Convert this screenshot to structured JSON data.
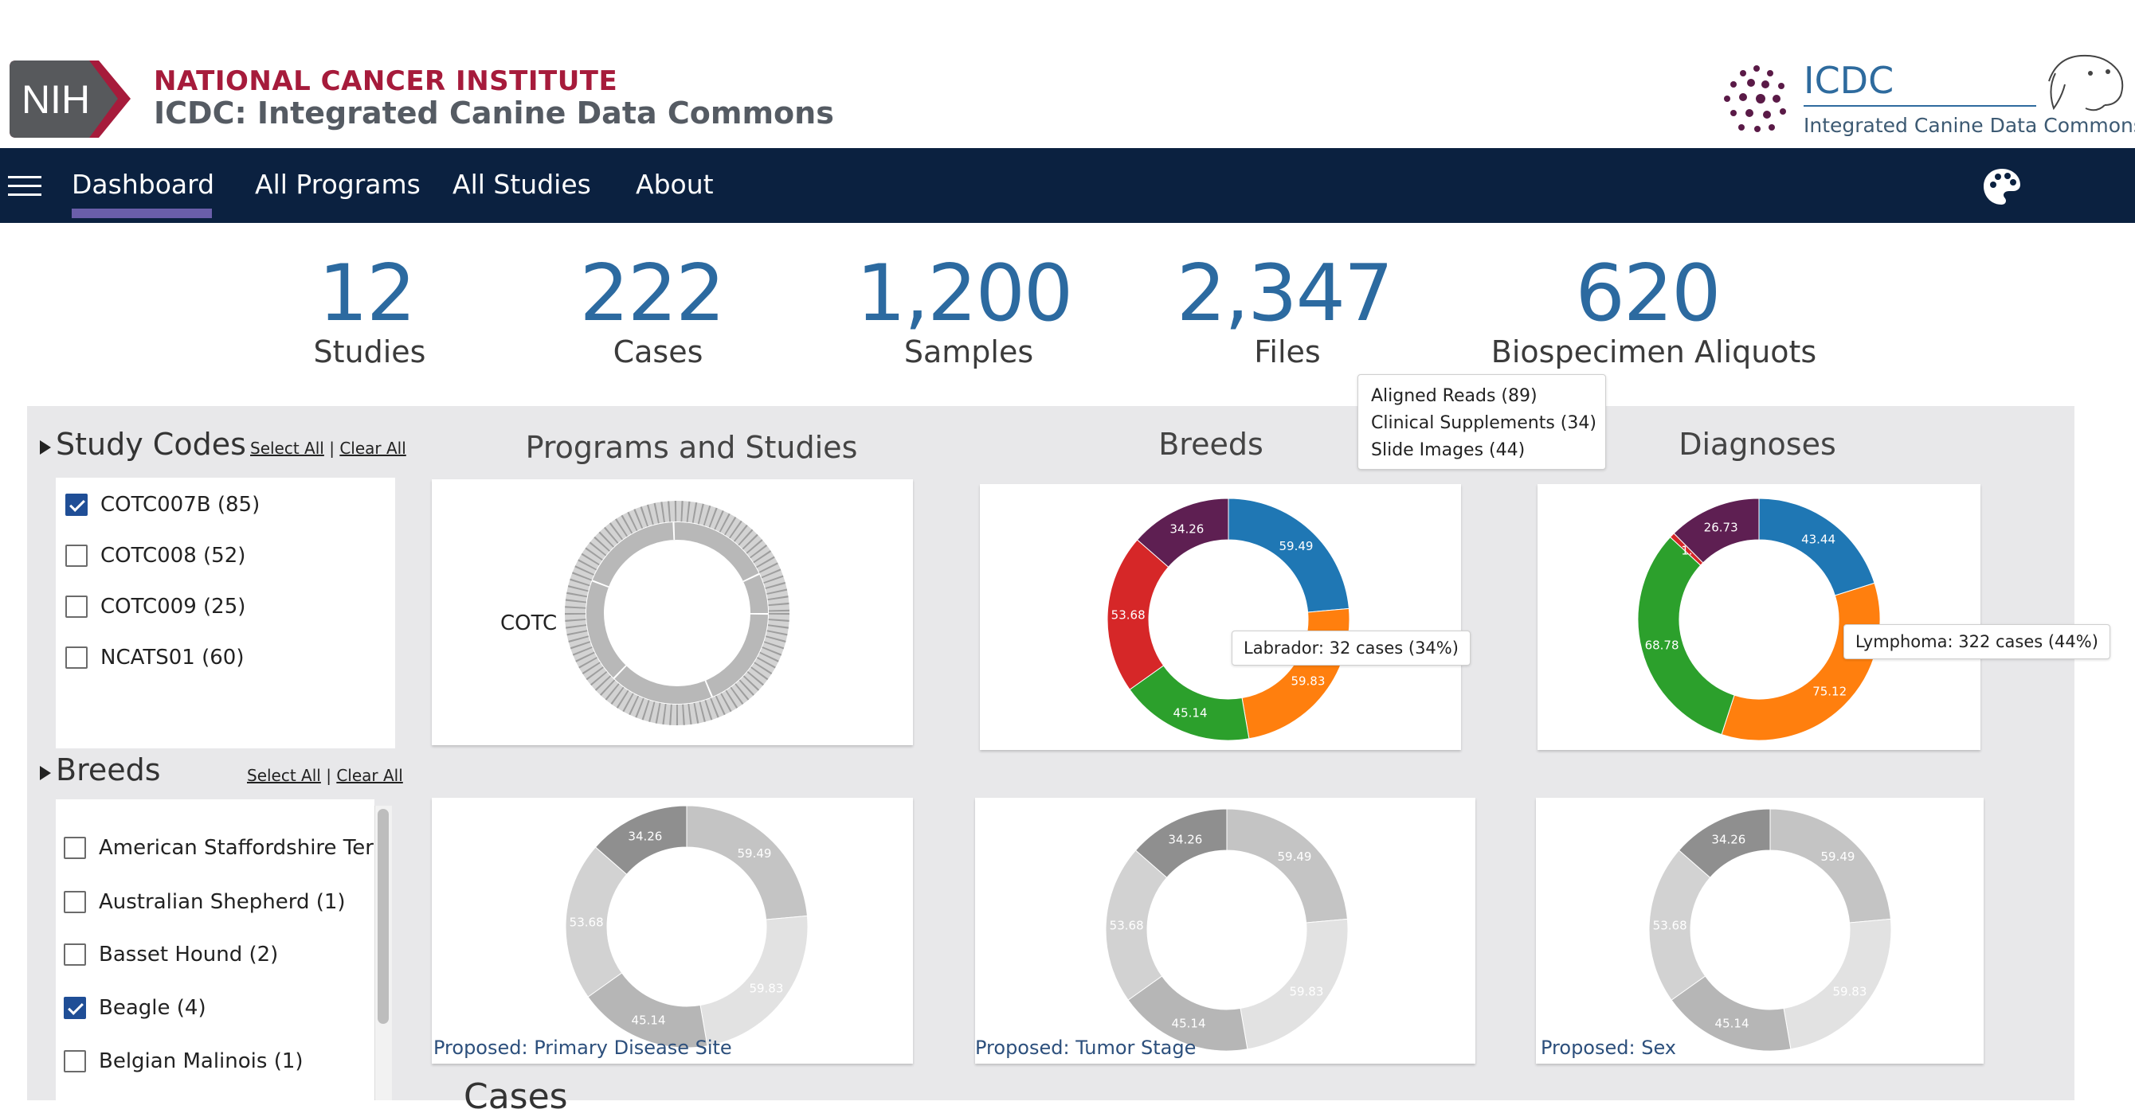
{
  "header": {
    "nih_logo_text": "NIH",
    "nci_title": "NATIONAL CANCER INSTITUTE",
    "icdc_title": "ICDC: Integrated Canine Data Commons",
    "icdc_logo_word": "ICDC",
    "icdc_logo_sub": "Integrated Canine Data Commons"
  },
  "nav": {
    "items": [
      "Dashboard",
      "All Programs",
      "All Studies",
      "About"
    ],
    "active": "Dashboard"
  },
  "stats": [
    {
      "value": "12",
      "label": "Studies"
    },
    {
      "value": "222",
      "label": "Cases"
    },
    {
      "value": "1,200",
      "label": "Samples"
    },
    {
      "value": "2,347",
      "label": "Files"
    },
    {
      "value": "620",
      "label": "Biospecimen Aliquots"
    }
  ],
  "files_tooltip": [
    "Aligned Reads (89)",
    "Clinical Supplements (34)",
    "Slide Images (44)"
  ],
  "facets": {
    "study_codes": {
      "title": "Study Codes",
      "select_all": "Select All",
      "separator": "|",
      "clear_all": "Clear All",
      "items": [
        {
          "label": "COTC007B (85)",
          "checked": true
        },
        {
          "label": "COTC008 (52)",
          "checked": false
        },
        {
          "label": "COTC009 (25)",
          "checked": false
        },
        {
          "label": "NCATS01 (60)",
          "checked": false
        }
      ]
    },
    "breeds": {
      "title": "Breeds",
      "select_all": "Select All",
      "separator": "|",
      "clear_all": "Clear All",
      "items": [
        {
          "label": "American Staffordshire Teri",
          "checked": false
        },
        {
          "label": "Australian Shepherd (1)",
          "checked": false
        },
        {
          "label": "Basset Hound (2)",
          "checked": false
        },
        {
          "label": "Beagle (4)",
          "checked": true
        },
        {
          "label": "Belgian Malinois (1)",
          "checked": false
        }
      ]
    }
  },
  "charts": {
    "programs_title": "Programs and Studies",
    "programs_label": "COTC",
    "breeds_title": "Breeds",
    "diagnoses_title": "Diagnoses",
    "labrador_tooltip": "Labrador:  32 cases  (34%)",
    "lymphoma_tooltip": "Lymphoma: 322 cases  (44%)",
    "proposed_primary": "Proposed: Primary Disease Site",
    "proposed_tumor": "Proposed: Tumor Stage",
    "proposed_sex": "Proposed: Sex"
  },
  "chart_data": [
    {
      "type": "pie",
      "title": "Breeds",
      "values": [
        59.49,
        59.83,
        45.14,
        53.68,
        34.26
      ],
      "labels": [
        "59.49",
        "59.83",
        "45.14",
        "53.68",
        "34.26"
      ],
      "colors": [
        "#1f77b4",
        "#ff7f0e",
        "#2ca02c",
        "#d62728",
        "#5e1f52"
      ]
    },
    {
      "type": "pie",
      "title": "Diagnoses",
      "values": [
        43.44,
        75.12,
        68.78,
        1.5,
        26.73
      ],
      "labels": [
        "43.44",
        "75.12",
        "68.78",
        "1.",
        "26.73"
      ],
      "colors": [
        "#1f77b4",
        "#ff7f0e",
        "#2ca02c",
        "#d62728",
        "#5e1f52"
      ]
    },
    {
      "type": "pie",
      "title": "Proposed: Primary Disease Site",
      "values": [
        59.49,
        59.83,
        45.14,
        53.68,
        34.26
      ],
      "labels": [
        "59.49",
        "59.83",
        "45.14",
        "53.68",
        "34.26"
      ],
      "colors": [
        "#c4c4c4",
        "#e2e2e2",
        "#b6b6b6",
        "#d2d2d2",
        "#8f8f8f"
      ]
    },
    {
      "type": "pie",
      "title": "Proposed: Tumor Stage",
      "values": [
        59.49,
        59.83,
        45.14,
        53.68,
        34.26
      ],
      "labels": [
        "59.49",
        "59.83",
        "45.14",
        "53.68",
        "34.26"
      ],
      "colors": [
        "#c4c4c4",
        "#e2e2e2",
        "#b6b6b6",
        "#d2d2d2",
        "#8f8f8f"
      ]
    },
    {
      "type": "pie",
      "title": "Proposed: Sex",
      "values": [
        59.49,
        59.83,
        45.14,
        53.68,
        34.26
      ],
      "labels": [
        "59.49",
        "59.83",
        "45.14",
        "53.68",
        "34.26"
      ],
      "colors": [
        "#c4c4c4",
        "#e2e2e2",
        "#b6b6b6",
        "#d2d2d2",
        "#8f8f8f"
      ]
    }
  ],
  "cases_heading": "Cases"
}
